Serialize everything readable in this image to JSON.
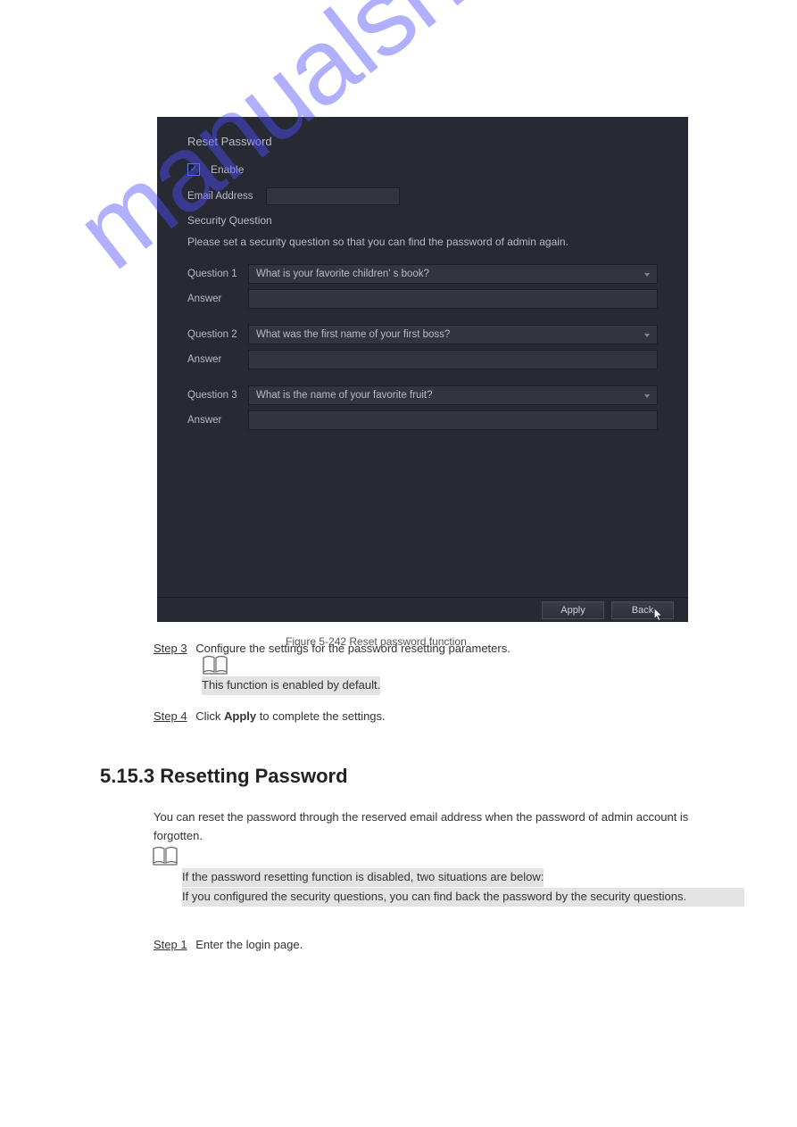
{
  "watermark": "manualshive.com",
  "screenshot": {
    "title": "Reset Password",
    "enable_label": "Enable",
    "email_label": "Email Address",
    "security_title": "Security Question",
    "instruction": "Please set a security question so that you can find the password of admin again.",
    "q1_label": "Question 1",
    "q1_value": "What is your favorite children' s book?",
    "q2_label": "Question 2",
    "q2_value": "What was the first name of your first boss?",
    "q3_label": "Question 3",
    "q3_value": "What is the name of your favorite fruit?",
    "answer_label": "Answer",
    "apply": "Apply",
    "back": "Back"
  },
  "caption": "Figure 5-242 Reset password function",
  "step3": "Step 3",
  "step3_text": "Configure the settings for the password resetting parameters.",
  "note1": "This function is enabled by default.",
  "step4": "Step 4",
  "step4_bold": "Apply",
  "step4_text": " to complete the settings.",
  "step4_click": "Click ",
  "section_title": "5.15.3 Resetting Password",
  "section_text": "You can reset the password through the reserved email address when the password of admin account is forgotten.",
  "note2a": "If the password resetting function is disabled, two situations are below:",
  "note2b": "If you configured the security questions, you can find back the password by the security questions.",
  "step1": "Step 1",
  "step1_text": "Enter the login page."
}
